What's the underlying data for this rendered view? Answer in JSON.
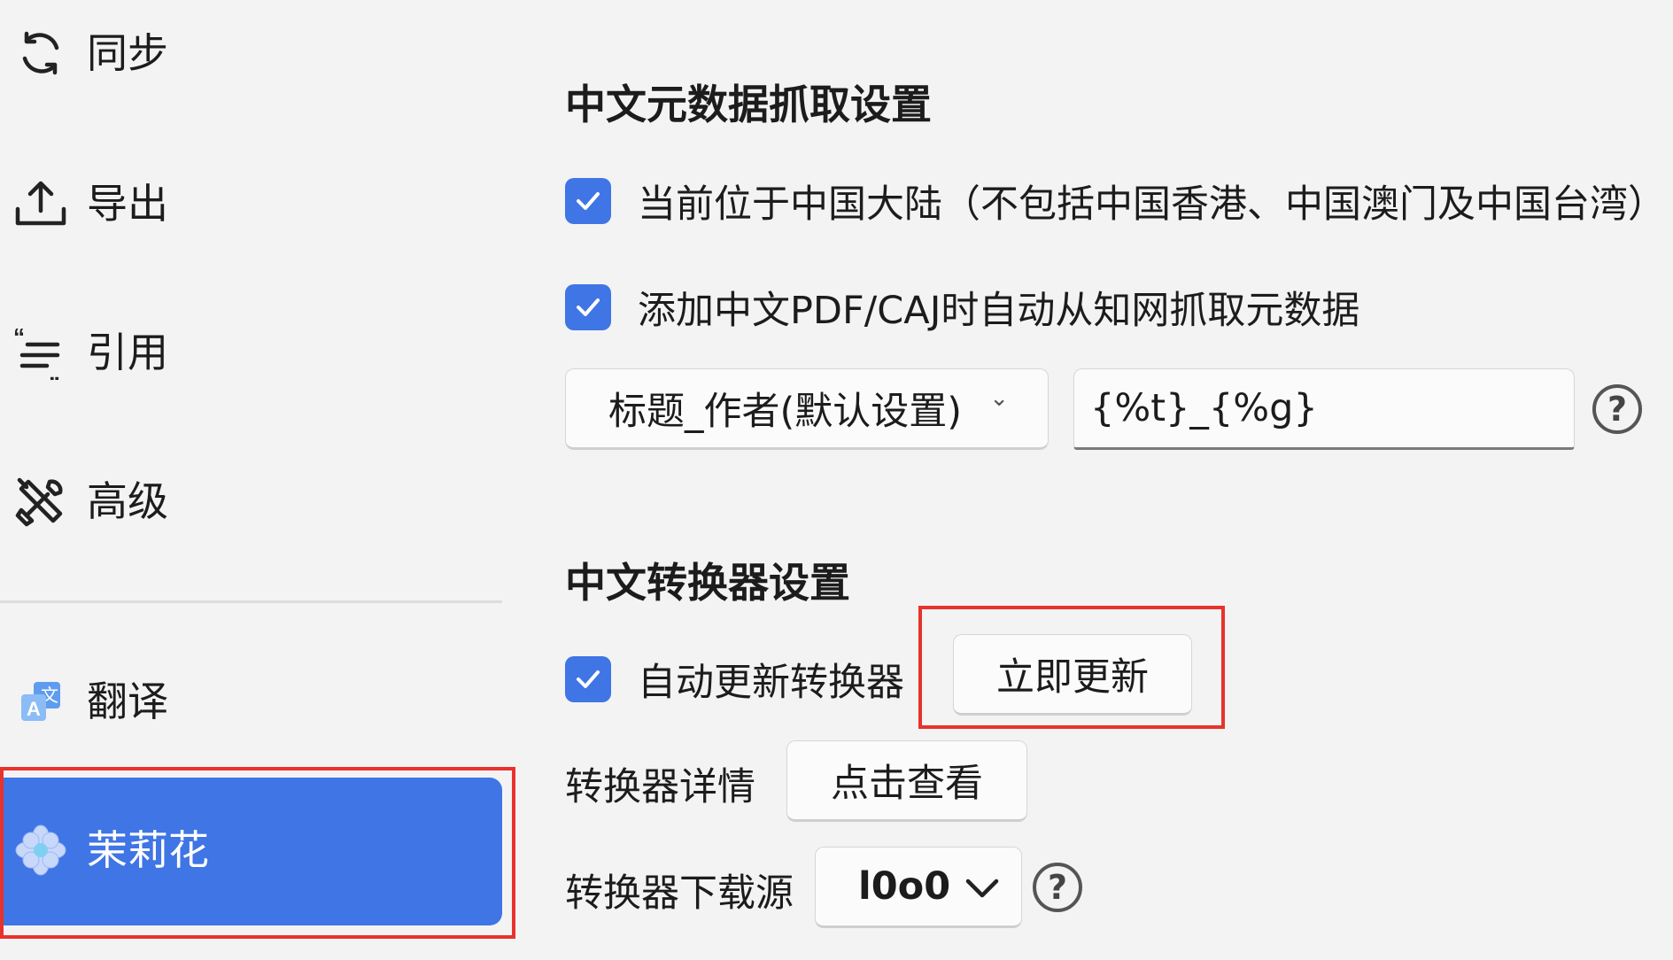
{
  "sidebar": {
    "items": [
      {
        "label": "同步",
        "icon": "sync-icon"
      },
      {
        "label": "导出",
        "icon": "export-icon"
      },
      {
        "label": "引用",
        "icon": "cite-icon"
      },
      {
        "label": "高级",
        "icon": "tools-icon"
      },
      {
        "label": "翻译",
        "icon": "translate-icon"
      },
      {
        "label": "茉莉花",
        "icon": "jasmine-flower-icon"
      }
    ],
    "active_item": "茉莉花"
  },
  "main": {
    "metadata_section": {
      "title": "中文元数据抓取设置",
      "options": [
        {
          "label": "当前位于中国大陆（不包括中国香港、中国澳门及中国台湾）",
          "checked": true
        },
        {
          "label": "添加中文PDF/CAJ时自动从知网抓取元数据",
          "checked": true
        }
      ],
      "rename_select": {
        "value": "标题_作者(默认设置)",
        "chevron": "⌄"
      },
      "rename_template": {
        "value": "{%t}_{%g}"
      }
    },
    "converter_section": {
      "title": "中文转换器设置",
      "auto_update": {
        "label": "自动更新转换器",
        "checked": true
      },
      "update_button": "立即更新",
      "details": {
        "label": "转换器详情",
        "button": "点击查看"
      },
      "source": {
        "label": "转换器下载源",
        "value": "l0o0"
      }
    }
  },
  "colors": {
    "accent": "#3f75e5",
    "highlight": "#e8322c",
    "background": "#f3f3f3"
  }
}
